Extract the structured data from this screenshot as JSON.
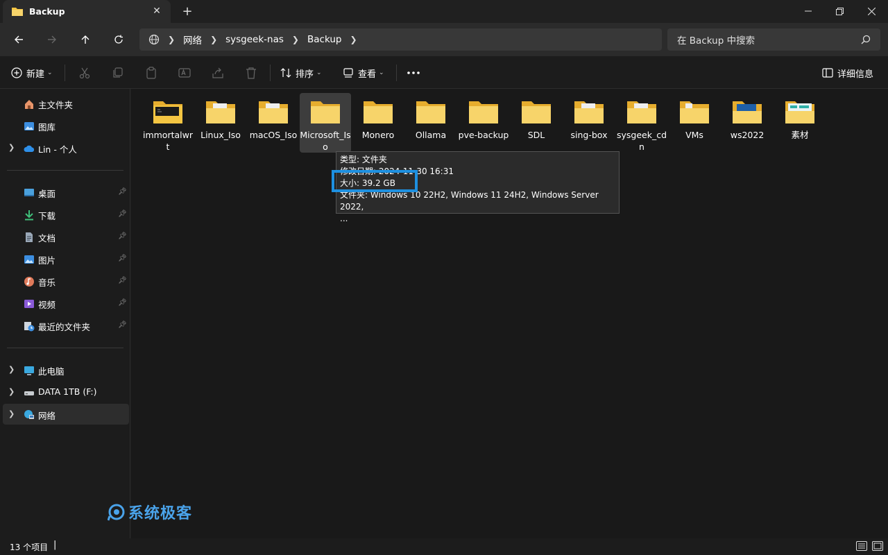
{
  "window": {
    "tab_title": "Backup",
    "close_tab": "✕",
    "new_tab": "+"
  },
  "address": {
    "crumbs": [
      "网络",
      "sysgeek-nas",
      "Backup"
    ]
  },
  "search": {
    "placeholder": "在 Backup 中搜索"
  },
  "toolbar": {
    "new_label": "新建",
    "sort_label": "排序",
    "view_label": "查看",
    "details_label": "详细信息"
  },
  "sidebar": {
    "items": [
      {
        "label": "主文件夹"
      },
      {
        "label": "图库"
      },
      {
        "label": "Lin - 个人"
      },
      {
        "label": "桌面"
      },
      {
        "label": "下载"
      },
      {
        "label": "文档"
      },
      {
        "label": "图片"
      },
      {
        "label": "音乐"
      },
      {
        "label": "视频"
      },
      {
        "label": "最近的文件夹"
      },
      {
        "label": "此电脑"
      },
      {
        "label": "DATA 1TB (F:)"
      },
      {
        "label": "网络"
      }
    ]
  },
  "folders": [
    {
      "name": "immortalwrt"
    },
    {
      "name": "Linux_Iso"
    },
    {
      "name": "macOS_Iso"
    },
    {
      "name": "Microsoft_Iso"
    },
    {
      "name": "Monero"
    },
    {
      "name": "Ollama"
    },
    {
      "name": "pve-backup"
    },
    {
      "name": "SDL"
    },
    {
      "name": "sing-box"
    },
    {
      "name": "sysgeek_cdn"
    },
    {
      "name": "VMs"
    },
    {
      "name": "ws2022"
    },
    {
      "name": "素材"
    }
  ],
  "tooltip": {
    "type": "类型: 文件夹",
    "modified": "修改日期: 2024-11-30 16:31",
    "size": "大小: 39.2 GB",
    "files": "文件夹: Windows 10 22H2, Windows 11 24H2, Windows Server 2022,",
    "more": "..."
  },
  "watermark": {
    "text": "系统极客"
  },
  "status": {
    "count": "13 个项目"
  },
  "colors": {
    "accent": "#1e90e0",
    "folder": "#f4c542",
    "background": "#191919"
  }
}
